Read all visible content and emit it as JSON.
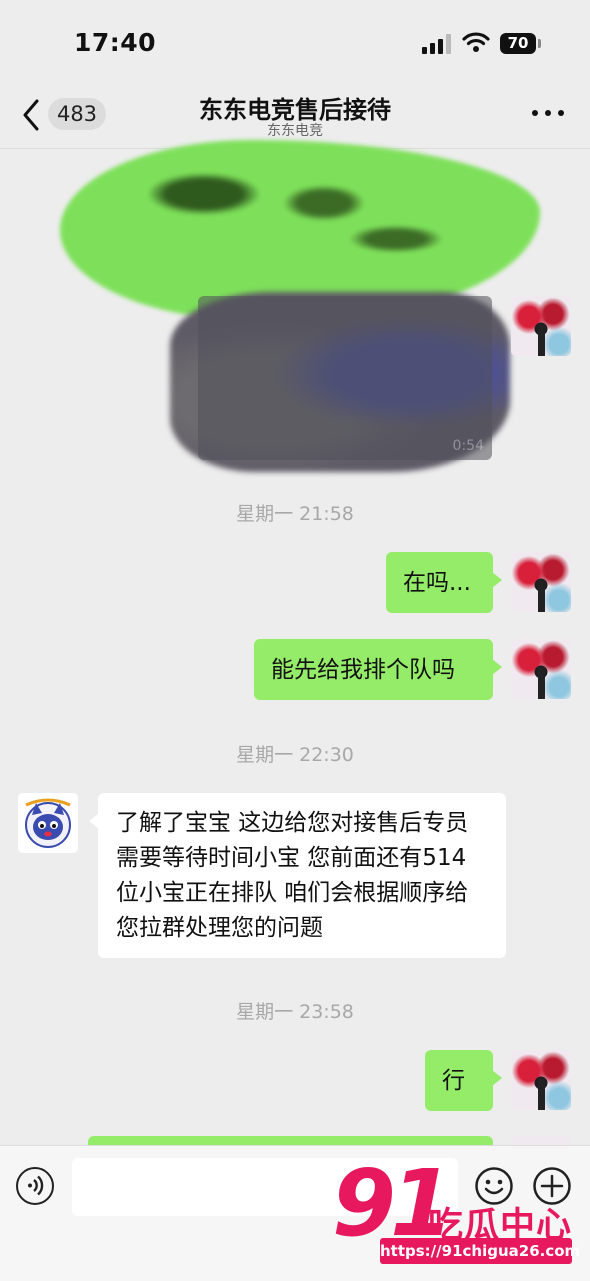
{
  "status_bar": {
    "time": "17:40",
    "battery": "70"
  },
  "header": {
    "unread_count": "483",
    "title": "东东电竞售后接待",
    "subtitle": "东东电竞"
  },
  "chat": {
    "video_duration": "0:54",
    "timestamps": [
      "星期一 21:58",
      "星期一 22:30",
      "星期一 23:58"
    ],
    "messages": [
      {
        "text": "在吗..."
      },
      {
        "text": "能先给我排个队吗"
      },
      {
        "text": "了解了宝宝  这边给您对接售后专员  需要等待时间小宝  您前面还有514位小宝正在排队  咱们会根据顺序给您拉群处理您的问题"
      },
      {
        "text": "行"
      }
    ]
  },
  "input": {
    "value": ""
  },
  "watermark": {
    "number": "91",
    "name": "吃瓜中心",
    "url": "https://91chigua26.com"
  },
  "colors": {
    "out_bubble": "#95ec69",
    "in_bubble": "#ffffff",
    "background": "#ededed",
    "watermark": "#e8185e"
  },
  "icons": [
    "back-icon",
    "more-icon",
    "signal-icon",
    "wifi-icon",
    "battery-icon",
    "voice-icon",
    "emoji-icon",
    "plus-icon"
  ]
}
